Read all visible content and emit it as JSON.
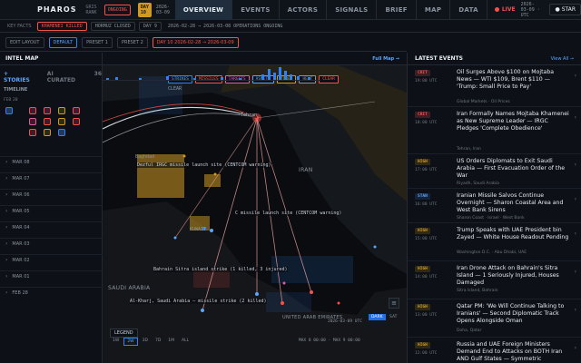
{
  "header": {
    "brand": "PHAROS",
    "subbrand": "GRIS RANK",
    "status": "ONGOING",
    "day_label": "DAY 10",
    "date": "2026-03-09",
    "nav": [
      "OVERVIEW",
      "EVENTS",
      "ACTORS",
      "SIGNALS",
      "BRIEF",
      "MAP",
      "DATA"
    ],
    "active_nav": "OVERVIEW",
    "live": "LIVE",
    "clock": "2026-03-09 · UTC",
    "star": "STAR"
  },
  "keyfacts": {
    "label": "KEY FACTS",
    "items": [
      "KHAMENEI KILLED",
      "HORMUZ CLOSED"
    ],
    "day_tag": "DAY 9",
    "meta": "2026-02-28 → 2026-03-08   OPERATIONS ONGOING"
  },
  "toolbar": {
    "edit_layout": "EDIT LAYOUT",
    "presets": [
      "DEFAULT",
      "PRESET 1",
      "PRESET 2"
    ],
    "range": "DAY 10  2026-02-28 → 2026-03-09"
  },
  "intel": {
    "title": "INTEL MAP",
    "full_map": "Full Map →",
    "tabs": [
      "+ STORIES",
      "AI CURATED"
    ],
    "tab_count": "36",
    "timeline_label": "TIMELINE",
    "timeline_date": "FEB 28",
    "days": [
      "MAR 08",
      "MAR 07",
      "MAR 06",
      "MAR 05",
      "MAR 04",
      "MAR 03",
      "MAR 02",
      "MAR 01",
      "FEB 28"
    ]
  },
  "map": {
    "filters": [
      "STRIKES",
      "MISSILES",
      "TARGETS",
      "ASSETS",
      "ZONES",
      "HEAT",
      "CLEAR"
    ],
    "clear_small": "CLEAR",
    "labels": {
      "tehran": "Tehran",
      "baghdad": "Baghdad",
      "dezful": "Dezful  IRGC missile launch site (CENTCOM warning)",
      "kharg": "C missile launch site (CENTCOM warning)",
      "bahrain": "Bahrain Sitra island strike (1 killed, 3 injured)",
      "riyadh": "Al-Kharj, Saudi Arabia — missile strike (2 killed)",
      "saudi": "SAUDI ARABIA",
      "iran": "IRAN",
      "uae": "UNITED ARAB EMIRATES",
      "kuwait": "KUWAIT"
    },
    "legend": "LEGEND",
    "zoom": [
      "1W",
      "2W",
      "3D",
      "7D",
      "1M",
      "ALL"
    ],
    "zoom_active": "2W",
    "date": "2026-03-09 UTC",
    "dark": "DARK",
    "sat": "SAT",
    "max_label": "MAX 8 00:00 · MAX 9 00:00"
  },
  "events": {
    "title": "LATEST EVENTS",
    "view_all": "View All →",
    "items": [
      {
        "severity": "CRIT",
        "time": "19:00 UTC",
        "title": "Oil Surges Above $100 on Mojtaba News — WTI $109, Brent $110 — 'Trump: Small Price to Pay'",
        "source": "Global Markets · Oil Prices"
      },
      {
        "severity": "CRIT",
        "time": "18:00 UTC",
        "title": "Iran Formally Names Mojtaba Khamenei as New Supreme Leader — IRGC Pledges 'Complete Obedience'",
        "source": "Tehran, Iran"
      },
      {
        "severity": "HIGH",
        "time": "17:00 UTC",
        "title": "US Orders Diplomats to Exit Saudi Arabia — First Evacuation Order of the War",
        "source": "Riyadh, Saudi Arabia"
      },
      {
        "severity": "STAN",
        "time": "16:00 UTC",
        "title": "Iranian Missile Salvos Continue Overnight — Sharon Coastal Area and West Bank Sirens",
        "source": "Sharon Coast · Israel · West Bank"
      },
      {
        "severity": "HIGH",
        "time": "15:00 UTC",
        "title": "Trump Speaks with UAE President bin Zayed — White House Readout Pending",
        "source": "Washington D.C. · Abu Dhabi, UAE"
      },
      {
        "severity": "HIGH",
        "time": "14:00 UTC",
        "title": "Iran Drone Attack on Bahrain's Sitra Island — 1 Seriously Injured, Houses Damaged",
        "source": "Sitra Island, Bahrain"
      },
      {
        "severity": "HIGH",
        "time": "13:00 UTC",
        "title": "Qatar PM: 'We Will Continue Talking to Iranians' — Second Diplomatic Track Opens Alongside Oman",
        "source": "Doha, Qatar"
      },
      {
        "severity": "HIGH",
        "time": "12:00 UTC",
        "title": "Russia and UAE Foreign Ministers Demand End to Attacks on BOTH Iran AND Gulf States — Symmetric",
        "source": ""
      }
    ]
  },
  "colors": {
    "crit": "#f85149",
    "high": "#d29922",
    "stan": "#2f81f7",
    "accent": "#58a6ff"
  }
}
